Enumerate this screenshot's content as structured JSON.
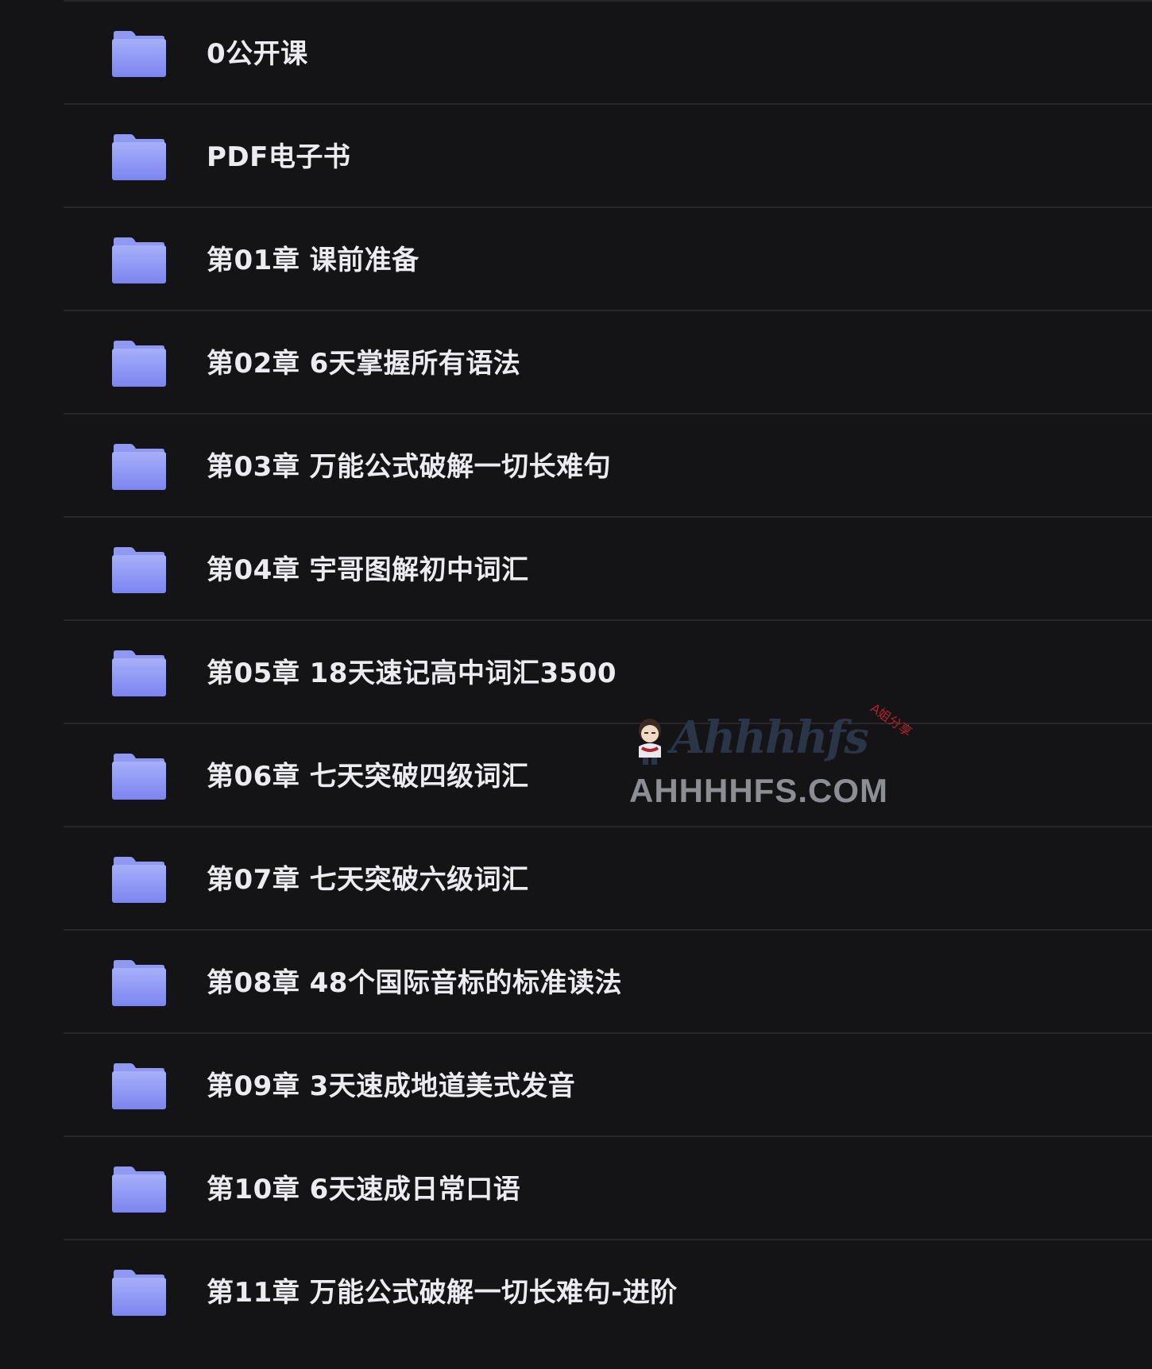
{
  "folders": [
    {
      "name": "0公开课",
      "icon": "folder-icon"
    },
    {
      "name": "PDF电子书",
      "icon": "folder-icon"
    },
    {
      "name": "第01章 课前准备",
      "icon": "folder-icon"
    },
    {
      "name": "第02章 6天掌握所有语法",
      "icon": "folder-icon"
    },
    {
      "name": "第03章 万能公式破解一切长难句",
      "icon": "folder-icon"
    },
    {
      "name": "第04章 宇哥图解初中词汇",
      "icon": "folder-icon"
    },
    {
      "name": "第05章 18天速记高中词汇3500",
      "icon": "folder-icon"
    },
    {
      "name": "第06章 七天突破四级词汇",
      "icon": "folder-icon"
    },
    {
      "name": "第07章 七天突破六级词汇",
      "icon": "folder-icon"
    },
    {
      "name": "第08章 48个国际音标的标准读法",
      "icon": "folder-icon"
    },
    {
      "name": "第09章 3天速成地道美式发音",
      "icon": "folder-icon"
    },
    {
      "name": "第10章 6天速成日常口语",
      "icon": "folder-icon"
    },
    {
      "name": "第11章 万能公式破解一切长难句-进阶",
      "icon": "folder-icon"
    }
  ],
  "watermark": {
    "script_text": "Ahhhhfs",
    "badge": "A姐分享",
    "domain": "AHHHHFS.COM"
  },
  "colors": {
    "background": "#141416",
    "divider": "#27272b",
    "text": "#ececf0",
    "folder_top": "#9aa6f7",
    "folder_bottom": "#7f86f2"
  }
}
